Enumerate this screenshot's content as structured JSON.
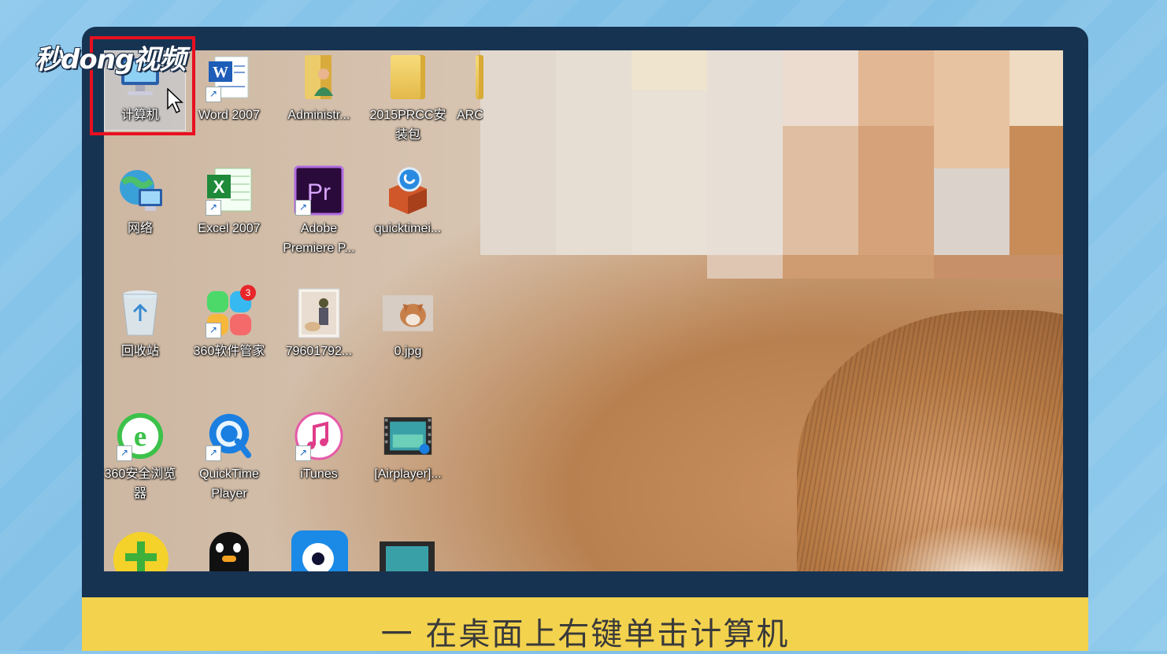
{
  "watermark": {
    "logo_text": "秒dong视频"
  },
  "desktop": {
    "icons": [
      {
        "label": "计算机",
        "icon": "computer-icon"
      },
      {
        "label": "Word 2007",
        "icon": "word-icon"
      },
      {
        "label": "Administr...",
        "icon": "user-folder-icon"
      },
      {
        "label": "2015PRCC安\n装包",
        "icon": "folder-icon"
      },
      {
        "label": "ARC",
        "icon": "folder-icon"
      },
      {
        "label": "网络",
        "icon": "network-icon"
      },
      {
        "label": "Excel 2007",
        "icon": "excel-icon"
      },
      {
        "label": "Adobe\nPremiere P...",
        "icon": "premiere-icon"
      },
      {
        "label": "quicktimei...",
        "icon": "installer-icon"
      },
      {
        "label": "回收站",
        "icon": "recycle-bin-icon"
      },
      {
        "label": "360软件管家",
        "icon": "360-software-icon"
      },
      {
        "label": "79601792...",
        "icon": "image-thumbnail-icon"
      },
      {
        "label": "0.jpg",
        "icon": "image-thumbnail-icon"
      },
      {
        "label": "360安全浏览\n器",
        "icon": "360-browser-icon"
      },
      {
        "label": "QuickTime\nPlayer",
        "icon": "quicktime-icon"
      },
      {
        "label": "iTunes",
        "icon": "itunes-icon"
      },
      {
        "label": "[Airplayer]...",
        "icon": "video-icon"
      }
    ],
    "badge_360": "3",
    "colors": {
      "highlight": "#e81020",
      "subtitle_bg": "#f3d24e",
      "bezel": "#173352"
    }
  },
  "subtitle": {
    "text": "一 在桌面上右键单击计算机"
  }
}
